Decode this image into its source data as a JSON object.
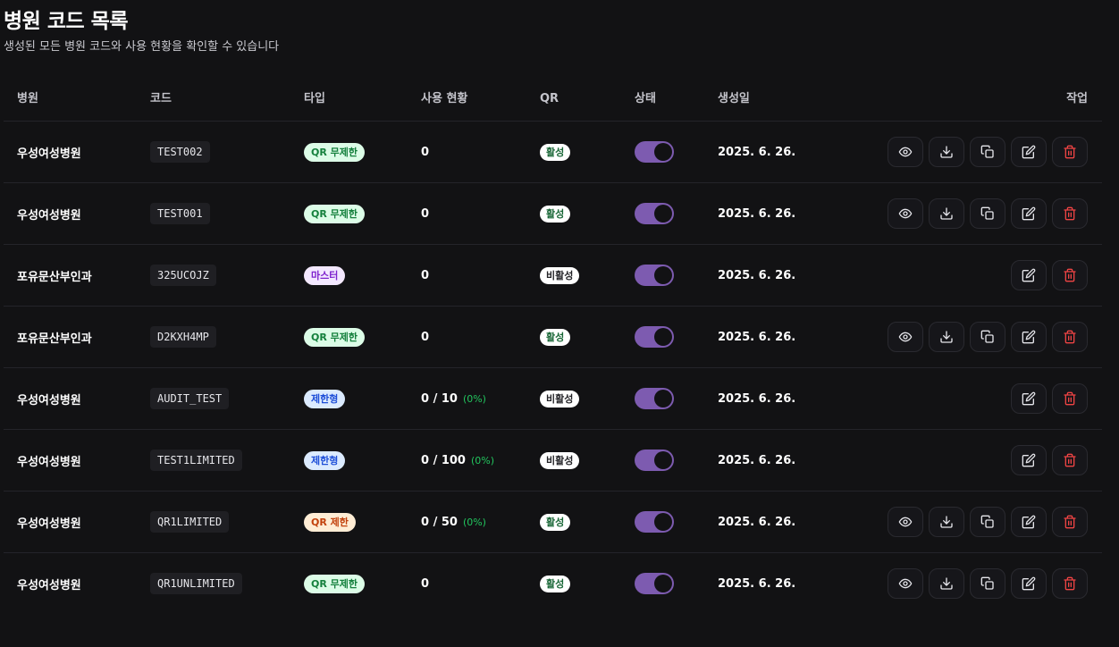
{
  "page": {
    "title": "병원 코드 목록",
    "subtitle": "생성된 모든 병원 코드와 사용 현황을 확인할 수 있습니다"
  },
  "columns": {
    "hospital": "병원",
    "code": "코드",
    "type": "타입",
    "usage": "사용 현황",
    "qr": "QR",
    "status": "상태",
    "created": "생성일",
    "actions": "작업"
  },
  "icons": {
    "view": "eye-icon",
    "download": "download-icon",
    "copy": "copy-icon",
    "edit": "edit-icon",
    "delete": "trash-icon"
  },
  "colors": {
    "toggle_on": "#7d5bb0",
    "delete": "#ef4444",
    "usage_percent": "#22c55e"
  },
  "rows": [
    {
      "hospital": "우성여성병원",
      "code": "TEST002",
      "type": "QR 무제한",
      "type_kind": "qr-unlimited",
      "usage": "0",
      "usage_percent": "",
      "qr": "활성",
      "qr_active": true,
      "status_on": true,
      "created": "2025. 6. 26.",
      "actions": [
        "view",
        "download",
        "copy",
        "edit",
        "delete"
      ]
    },
    {
      "hospital": "우성여성병원",
      "code": "TEST001",
      "type": "QR 무제한",
      "type_kind": "qr-unlimited",
      "usage": "0",
      "usage_percent": "",
      "qr": "활성",
      "qr_active": true,
      "status_on": true,
      "created": "2025. 6. 26.",
      "actions": [
        "view",
        "download",
        "copy",
        "edit",
        "delete"
      ]
    },
    {
      "hospital": "포유문산부인과",
      "code": "325UCOJZ",
      "type": "마스터",
      "type_kind": "master",
      "usage": "0",
      "usage_percent": "",
      "qr": "비활성",
      "qr_active": false,
      "status_on": true,
      "created": "2025. 6. 26.",
      "actions": [
        "edit",
        "delete"
      ]
    },
    {
      "hospital": "포유문산부인과",
      "code": "D2KXH4MP",
      "type": "QR 무제한",
      "type_kind": "qr-unlimited",
      "usage": "0",
      "usage_percent": "",
      "qr": "활성",
      "qr_active": true,
      "status_on": true,
      "created": "2025. 6. 26.",
      "actions": [
        "view",
        "download",
        "copy",
        "edit",
        "delete"
      ]
    },
    {
      "hospital": "우성여성병원",
      "code": "AUDIT_TEST",
      "type": "제한형",
      "type_kind": "limited",
      "usage": "0 / 10",
      "usage_percent": "(0%)",
      "qr": "비활성",
      "qr_active": false,
      "status_on": true,
      "created": "2025. 6. 26.",
      "actions": [
        "edit",
        "delete"
      ]
    },
    {
      "hospital": "우성여성병원",
      "code": "TEST1LIMITED",
      "type": "제한형",
      "type_kind": "limited",
      "usage": "0 / 100",
      "usage_percent": "(0%)",
      "qr": "비활성",
      "qr_active": false,
      "status_on": true,
      "created": "2025. 6. 26.",
      "actions": [
        "edit",
        "delete"
      ]
    },
    {
      "hospital": "우성여성병원",
      "code": "QR1LIMITED",
      "type": "QR 제한",
      "type_kind": "qr-limited",
      "usage": "0 / 50",
      "usage_percent": "(0%)",
      "qr": "활성",
      "qr_active": true,
      "status_on": true,
      "created": "2025. 6. 26.",
      "actions": [
        "view",
        "download",
        "copy",
        "edit",
        "delete"
      ]
    },
    {
      "hospital": "우성여성병원",
      "code": "QR1UNLIMITED",
      "type": "QR 무제한",
      "type_kind": "qr-unlimited",
      "usage": "0",
      "usage_percent": "",
      "qr": "활성",
      "qr_active": true,
      "status_on": true,
      "created": "2025. 6. 26.",
      "actions": [
        "view",
        "download",
        "copy",
        "edit",
        "delete"
      ]
    }
  ]
}
